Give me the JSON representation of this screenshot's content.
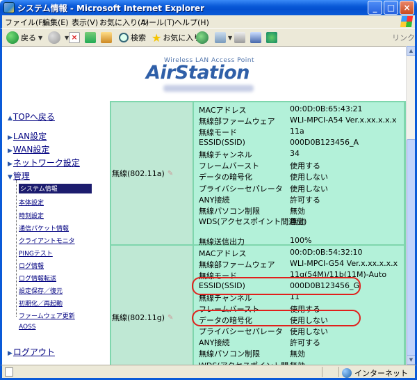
{
  "window": {
    "title": "システム情報 - Microsoft Internet Explorer"
  },
  "menubar": [
    "ファイル(F)",
    "編集(E)",
    "表示(V)",
    "お気に入り(A)",
    "ツール(T)",
    "ヘルプ(H)"
  ],
  "toolbar": {
    "back_label": "戻る",
    "search_label": "検索",
    "favorites_label": "お気に入り",
    "links_label": "リンク"
  },
  "logo": {
    "subtitle": "Wireless LAN Access Point",
    "name": "AirStation"
  },
  "nav": {
    "top": "TOPへ戻る",
    "lan": "LAN設定",
    "wan": "WAN設定",
    "network": "ネットワーク設定",
    "admin": "管理",
    "sub": [
      "システム情報",
      "本体設定",
      "時刻設定",
      "通信パケット情報",
      "クライアントモニタ",
      "PINGテスト",
      "ログ情報",
      "ログ情報転送",
      "設定保存／復元",
      "初期化／再起動",
      "ファームウェア更新",
      "AOSS"
    ],
    "logout": "ログアウト"
  },
  "wireless_a": {
    "label": "無線(802.11a)",
    "rows": [
      {
        "k": "MACアドレス",
        "v": "00:0D:0B:65:43:21"
      },
      {
        "k": "無線部ファームウェア",
        "v": "WLI-MPCI-A54 Ver.x.xx.x.x.x"
      },
      {
        "k": "無線モード",
        "v": "11a"
      },
      {
        "k": "ESSID(SSID)",
        "v": "000D0B123456_A"
      },
      {
        "k": "無線チャンネル",
        "v": "34"
      },
      {
        "k": "フレームバースト",
        "v": "使用する"
      },
      {
        "k": "データの暗号化",
        "v": "使用しない"
      },
      {
        "k": "プライバシーセパレータ",
        "v": "使用しない"
      },
      {
        "k": "ANY接続",
        "v": "許可する"
      },
      {
        "k": "無線パソコン制限",
        "v": "無効"
      },
      {
        "k": "WDS(アクセスポイント間通信)",
        "v": "無効"
      },
      {
        "k": "無線送信出力",
        "v": "100%"
      }
    ]
  },
  "wireless_g": {
    "label": "無線(802.11g)",
    "rows": [
      {
        "k": "MACアドレス",
        "v": "00:0D:0B:54:32:10"
      },
      {
        "k": "無線部ファームウェア",
        "v": "WLI-MPCI-G54 Ver.x.xx.x.x.x"
      },
      {
        "k": "無線モード",
        "v": "11g(54M)/11b(11M)-Auto"
      },
      {
        "k": "ESSID(SSID)",
        "v": "000D0B123456_G"
      },
      {
        "k": "無線チャンネル",
        "v": "11"
      },
      {
        "k": "フレームバースト",
        "v": "使用する"
      },
      {
        "k": "データの暗号化",
        "v": "使用しない"
      },
      {
        "k": "プライバシーセパレータ",
        "v": "使用しない"
      },
      {
        "k": "ANY接続",
        "v": "許可する"
      },
      {
        "k": "無線パソコン制限",
        "v": "無効"
      },
      {
        "k": "WDS(アクセスポイント間",
        "v": "無効"
      }
    ]
  },
  "status": {
    "zone": "インターネット"
  },
  "colors": {
    "table_bg": "#7fd6ad",
    "detail_bg": "#b3f1d9",
    "label_bg": "#bfe8d4",
    "highlight": "#e0201c",
    "nav_active": "#1c1c6e"
  }
}
